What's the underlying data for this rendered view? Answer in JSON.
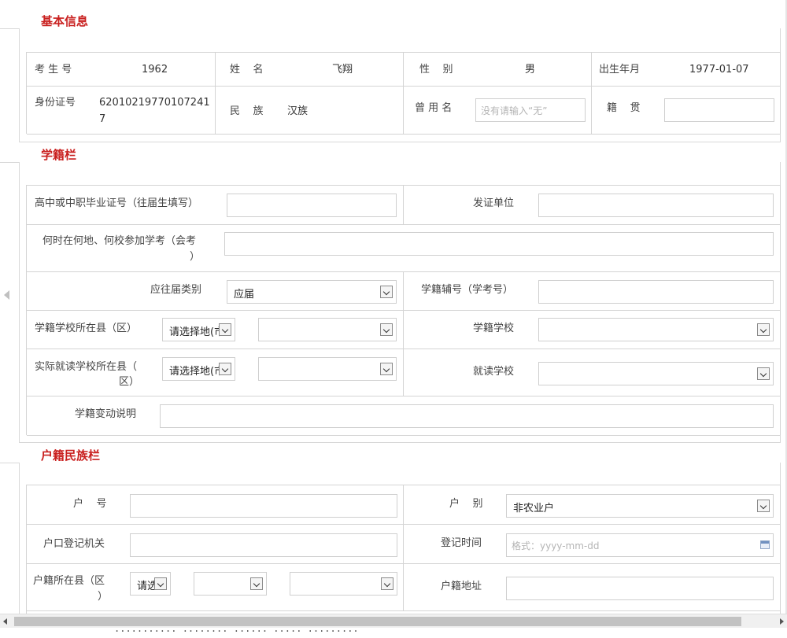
{
  "sections": {
    "basic": "基本信息",
    "school": "学籍栏",
    "household": "户籍民族栏"
  },
  "basic": {
    "exam_no_label": "考 生 号",
    "exam_no": "1962",
    "name_label": "姓    名",
    "name": "飞翔",
    "gender_label": "性    别",
    "gender": "男",
    "birth_label": "出生年月",
    "birth": "1977-01-07",
    "id_label": "身份证号",
    "id_line1": "62010219770107241",
    "id_line2": "7",
    "ethnic_label": "民    族",
    "ethnic": "汉族",
    "former_name_label": "曾 用 名",
    "former_name_placeholder": "没有请输入“无”",
    "native_label": "籍    贯"
  },
  "school": {
    "cert_label": "高中或中职毕业证号（往届生填写）",
    "issuer_label": "发证单位",
    "exam_when_label_1": "何时在何地、何校参加学考（会考",
    "exam_when_label_2": "）",
    "grad_type_label": "应往届类别",
    "grad_type_value": "应届",
    "aux_no_label": "学籍辅号（学考号）",
    "county_label": "学籍学校所在县（区）",
    "county_select": "请选择地(市",
    "school_label": "学籍学校",
    "actual_county_label_1": "实际就读学校所在县（",
    "actual_county_label_2": "区）",
    "actual_county_select": "请选择地(市",
    "actual_school_label": "就读学校",
    "change_label": "学籍变动说明"
  },
  "household": {
    "hukou_no_label": "户    号",
    "hukou_type_label": "户    别",
    "hukou_type_value": "非农业户",
    "reg_office_label": "户口登记机关",
    "reg_time_label": "登记时间",
    "reg_time_placeholder": "格式：yyyy-mm-dd",
    "county_label_1": "户籍所在县（区",
    "county_label_2": "）",
    "county_select": "请选",
    "address_label": "户籍地址"
  },
  "footer": {
    "text": "........... ........ ...... ..... ........."
  }
}
